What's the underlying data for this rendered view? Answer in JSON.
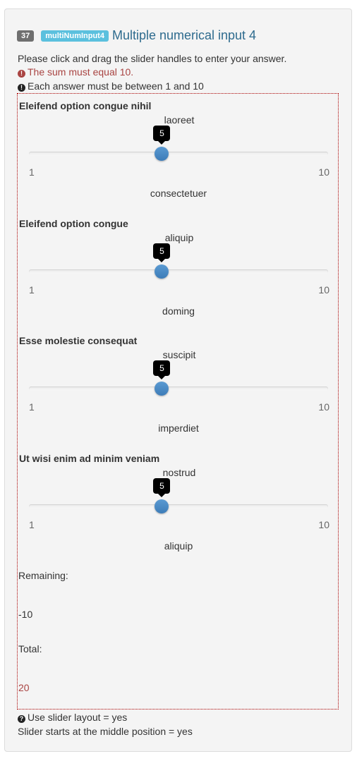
{
  "question": {
    "number": "37",
    "code": "multiNumInput4",
    "title": "Multiple numerical input 4",
    "help": "Please click and drag the slider handles to enter your answer.",
    "error": "The sum must equal 10.",
    "tip": "Each answer must be between 1 and 10"
  },
  "sliders": [
    {
      "label": "Eleifend option congue nihil",
      "left_text": "laoreet",
      "right_text": "consectetuer",
      "value": 5,
      "min_label": "1",
      "max_label": "10",
      "value_text": "5"
    },
    {
      "label": "Eleifend option congue",
      "left_text": "aliquip",
      "right_text": "doming",
      "value": 5,
      "min_label": "1",
      "max_label": "10",
      "value_text": "5"
    },
    {
      "label": "Esse molestie consequat",
      "left_text": "suscipit",
      "right_text": "imperdiet",
      "value": 5,
      "min_label": "1",
      "max_label": "10",
      "value_text": "5"
    },
    {
      "label": "Ut wisi enim ad minim veniam",
      "left_text": "nostrud",
      "right_text": "aliquip",
      "value": 5,
      "min_label": "1",
      "max_label": "10",
      "value_text": "5"
    }
  ],
  "slider_range": {
    "min": 1,
    "max": 10
  },
  "remaining_label": "Remaining:",
  "remaining_value": "-10",
  "total_label": "Total:",
  "total_value": "20",
  "footer": {
    "slider_layout": "Use slider layout = yes",
    "slider_middle": "Slider starts at the middle position = yes"
  },
  "colors": {
    "error": "#a94442",
    "title": "#2e6b8e",
    "badge_code": "#5bc0de",
    "badge_num": "#6f6f6f",
    "handle": "#428bca"
  }
}
